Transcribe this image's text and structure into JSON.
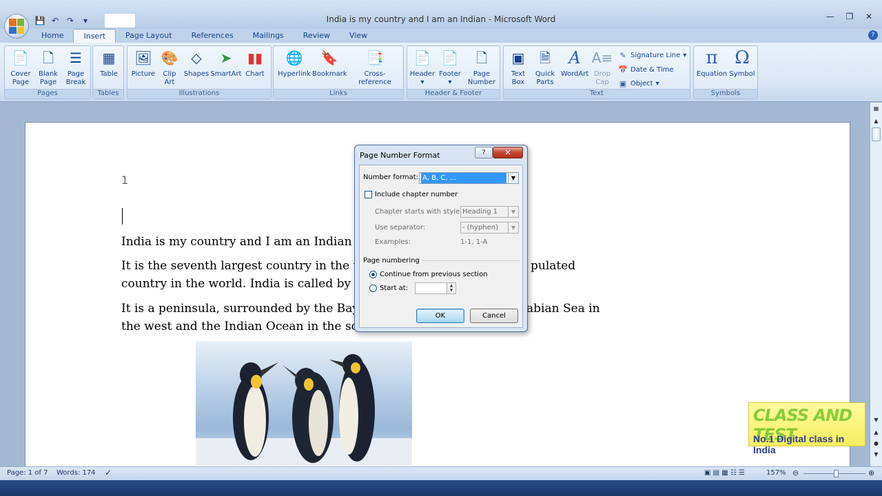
{
  "window": {
    "title": "India is my country and I am an Indian - Microsoft Word",
    "controls": [
      "minimize",
      "restore",
      "close"
    ]
  },
  "ribbon_tabs": [
    {
      "label": "Home",
      "active": false
    },
    {
      "label": "Insert",
      "active": true
    },
    {
      "label": "Page Layout",
      "active": false
    },
    {
      "label": "References",
      "active": false
    },
    {
      "label": "Mailings",
      "active": false
    },
    {
      "label": "Review",
      "active": false
    },
    {
      "label": "View",
      "active": false
    }
  ],
  "ribbon": {
    "pages": {
      "label": "Pages",
      "cover": "Cover\nPage",
      "blank": "Blank\nPage",
      "break": "Page\nBreak"
    },
    "tables": {
      "label": "Tables",
      "table": "Table"
    },
    "illustrations": {
      "label": "Illustrations",
      "picture": "Picture",
      "clipart": "Clip\nArt",
      "shapes": "Shapes",
      "smartart": "SmartArt",
      "chart": "Chart"
    },
    "links": {
      "label": "Links",
      "hyperlink": "Hyperlink",
      "bookmark": "Bookmark",
      "crossref": "Cross-reference"
    },
    "header_footer": {
      "label": "Header & Footer",
      "header": "Header",
      "footer": "Footer",
      "pagenum": "Page\nNumber"
    },
    "text": {
      "label": "Text",
      "textbox": "Text\nBox",
      "quickparts": "Quick\nParts",
      "wordart": "WordArt",
      "dropcap": "Drop\nCap",
      "signature": "Signature Line",
      "datetime": "Date & Time",
      "object": "Object"
    },
    "symbols": {
      "label": "Symbols",
      "equation": "Equation",
      "symbol": "Symbol"
    }
  },
  "document": {
    "page_number": "1",
    "para1": "India is my country and I am an Indian",
    "para2_line1": "It is the seventh largest country in the w",
    "para2_line1_right": "pulated",
    "para2_line2": "country in the world. India is called by",
    "para3_line1": "It is a peninsula, surrounded by the Bay",
    "para3_line1_right": "abian Sea in",
    "para3_line2": "the west and the Indian Ocean in the so"
  },
  "dialog": {
    "title": "Page Number Format",
    "help": "?",
    "close": "✕",
    "number_format_label": "Number format:",
    "number_format_value": "A, B, C, ...",
    "include_chapter_label": "Include chapter number",
    "include_chapter_checked": false,
    "chapter_style_label": "Chapter starts with style:",
    "chapter_style_value": "Heading 1",
    "separator_label": "Use separator:",
    "separator_value": "-  (hyphen)",
    "examples_label": "Examples:",
    "examples_value": "1-1, 1-A",
    "page_numbering_label": "Page numbering",
    "continue_label": "Continue from previous section",
    "start_at_label": "Start at:",
    "start_at_value": "",
    "selected_option": "continue",
    "ok_label": "OK",
    "cancel_label": "Cancel"
  },
  "statusbar": {
    "page": "Page: 1 of 7",
    "words": "Words: 174",
    "zoom": "157%"
  },
  "watermark": {
    "title": "CLASS AND TEST",
    "subtitle": "No.1 Digital class in India"
  },
  "colors": {
    "accent": "#15428b",
    "ribbon_bg": "#dae6f5",
    "selection": "#3399ff"
  }
}
